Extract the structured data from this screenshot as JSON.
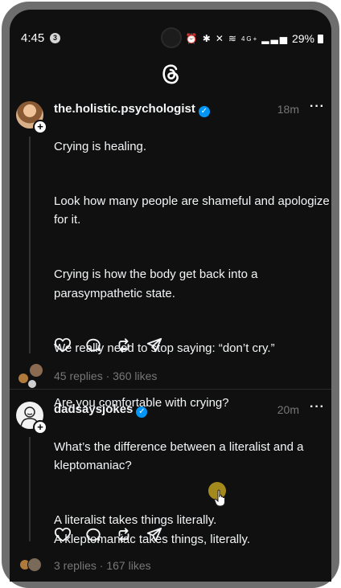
{
  "status_bar": {
    "time": "4:45",
    "notification_count": "3",
    "network": "4G+",
    "battery": "29%"
  },
  "app": {
    "logo": "threads-logo-icon"
  },
  "posts": [
    {
      "username": "the.holistic.psychologist",
      "timestamp": "18m",
      "more": "···",
      "paragraphs": [
        "Crying is healing.",
        "Look how many people are shameful and apologize for it.",
        "Crying is how the body get back into a parasympathetic state.",
        "We really need to stop saying: “don’t cry.”",
        "Are you comfortable with crying?"
      ],
      "stats": "45 replies · 360 likes"
    },
    {
      "username": "dadsaysjokes",
      "timestamp": "20m",
      "more": "···",
      "paragraphs": [
        "What’s the difference between a literalist and a kleptomaniac?",
        "A literalist takes things literally.\nA kleptomaniac takes things, literally."
      ],
      "stats": "3 replies · 167 likes"
    }
  ],
  "colors": {
    "background": "#101010",
    "text": "#f3f5f7",
    "muted": "#777777",
    "verified": "#0095f6"
  }
}
